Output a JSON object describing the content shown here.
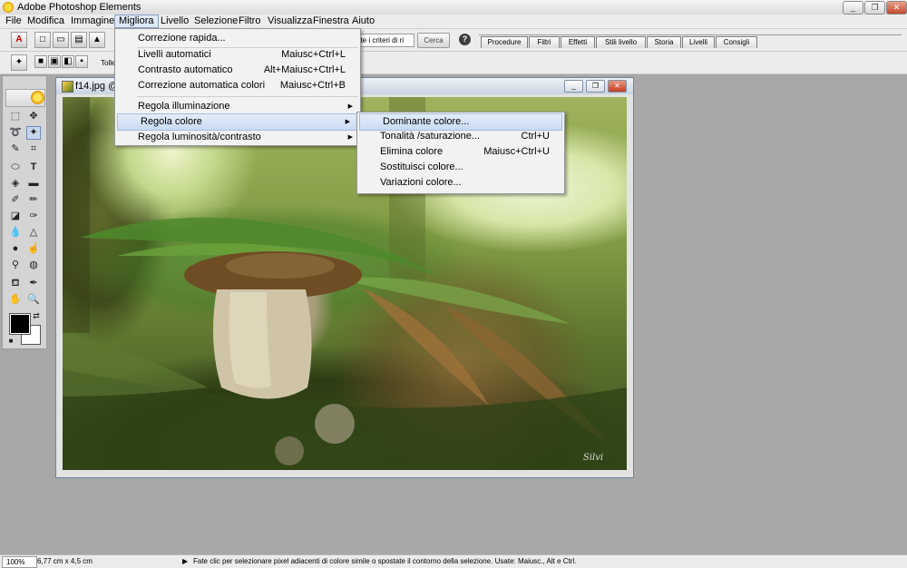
{
  "window": {
    "title": "Adobe Photoshop Elements",
    "buttons": [
      "_",
      "❐",
      "✕"
    ]
  },
  "menubar": [
    "File",
    "Modifica",
    "Immagine",
    "Migliora",
    "Livello",
    "Selezione",
    "Filtro",
    "Visualizza",
    "Finestra",
    "Aiuto"
  ],
  "toolbar": {
    "search_text": "ate i criteri di ri",
    "search_button": "Cerca",
    "help_icon": "help-icon"
  },
  "palette_tabs": [
    "Procedure",
    "Filtri",
    "Effetti",
    "Stili livello",
    "Storia",
    "Livelli",
    "Consigli"
  ],
  "options_bar": {
    "tolerance_label": "Tolle"
  },
  "document": {
    "title": "f14.jpg @",
    "signature": "Silvi",
    "buttons": [
      "_",
      "❐",
      "✕"
    ]
  },
  "migliora_menu": [
    {
      "label": "Correzione rapida...",
      "shortcut": ""
    },
    {
      "label": "Livelli automatici",
      "shortcut": "Maiusc+Ctrl+L"
    },
    {
      "label": "Contrasto automatico",
      "shortcut": "Alt+Maiusc+Ctrl+L"
    },
    {
      "label": "Correzione automatica colori",
      "shortcut": "Maiusc+Ctrl+B"
    },
    {
      "label": "Regola illuminazione",
      "shortcut": ""
    },
    {
      "label": "Regola colore",
      "shortcut": ""
    },
    {
      "label": "Regola luminosità/contrasto",
      "shortcut": ""
    }
  ],
  "regola_colore_submenu": [
    {
      "label": "Dominante colore...",
      "shortcut": ""
    },
    {
      "label": "Tonalità /saturazione...",
      "shortcut": "Ctrl+U"
    },
    {
      "label": "Elimina colore",
      "shortcut": "Maiusc+Ctrl+U"
    },
    {
      "label": "Sostituisci colore...",
      "shortcut": ""
    },
    {
      "label": "Variazioni colore...",
      "shortcut": ""
    }
  ],
  "statusbar": {
    "zoom": "100%",
    "dimensions": "6,77 cm x 4,5 cm",
    "hint": "Fate clic per selezionare pixel adiacenti di colore simile o spostate il contorno della selezione. Usate: Maiusc., Alt e Ctrl."
  },
  "colors": {
    "foreground": "#000000",
    "background": "#ffffff",
    "menu_highlight": "#c9dcf3"
  }
}
